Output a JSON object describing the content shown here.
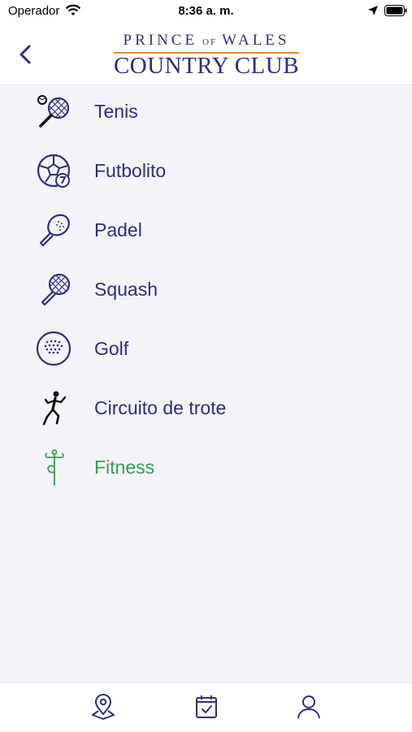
{
  "status_bar": {
    "carrier": "Operador",
    "time": "8:36 a. m."
  },
  "header": {
    "logo_line_1a": "PRINCE",
    "logo_line_1b": "OF",
    "logo_line_1c": "WALES",
    "logo_line_2": "COUNTRY CLUB"
  },
  "sports": [
    {
      "label": "Tenis",
      "icon": "tennis-racket-icon"
    },
    {
      "label": "Futbolito",
      "icon": "soccer-ball-icon"
    },
    {
      "label": "Padel",
      "icon": "padel-paddle-icon"
    },
    {
      "label": "Squash",
      "icon": "squash-racket-icon"
    },
    {
      "label": "Golf",
      "icon": "golf-ball-icon"
    },
    {
      "label": "Circuito de trote",
      "icon": "runner-icon"
    },
    {
      "label": "Fitness",
      "icon": "yoga-pose-icon",
      "active": true
    }
  ],
  "colors": {
    "primary": "#2e2f7a",
    "active": "#3d9a58",
    "logo_accent": "#d4913a",
    "background": "#f3f3f8"
  },
  "tab_bar": {
    "tabs": [
      "location-pin-icon",
      "calendar-check-icon",
      "user-profile-icon"
    ]
  }
}
